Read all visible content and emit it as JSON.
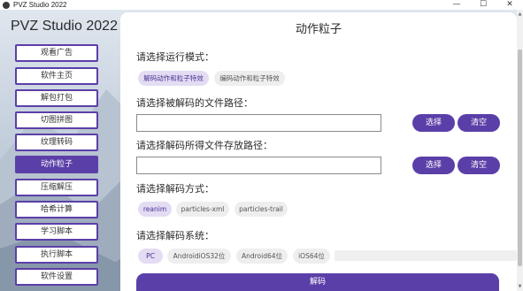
{
  "window": {
    "title": "PVZ Studio 2022",
    "icon": "pvz-logo-icon",
    "controls": {
      "minimize": "—",
      "maximize": "☐",
      "close": "✕"
    }
  },
  "sidebar": {
    "app_title": "PVZ Studio 2022",
    "items": [
      {
        "label": "观看广告",
        "active": false
      },
      {
        "label": "软件主页",
        "active": false
      },
      {
        "label": "解包打包",
        "active": false
      },
      {
        "label": "切图拼图",
        "active": false
      },
      {
        "label": "纹理转码",
        "active": false
      },
      {
        "label": "动作粒子",
        "active": true
      },
      {
        "label": "压缩解压",
        "active": false
      },
      {
        "label": "哈希计算",
        "active": false
      },
      {
        "label": "学习脚本",
        "active": false
      },
      {
        "label": "执行脚本",
        "active": false
      },
      {
        "label": "软件设置",
        "active": false
      }
    ]
  },
  "main": {
    "title": "动作粒子",
    "run_mode": {
      "label": "请选择运行模式：",
      "options": [
        "解码动作和粒子特效",
        "编码动作和粒子特效"
      ],
      "selected": 0
    },
    "input_path": {
      "label": "请选择被解码的文件路径：",
      "value": "",
      "choose": "选择",
      "clear": "清空"
    },
    "output_path": {
      "label": "请选择解码所得文件存放路径：",
      "value": "",
      "choose": "选择",
      "clear": "清空"
    },
    "decode_method": {
      "label": "请选择解码方式：",
      "options": [
        "reanim",
        "particles-xml",
        "particles-trail"
      ],
      "selected": 0
    },
    "decode_system": {
      "label": "请选择解码系统：",
      "options": [
        "PC",
        "AndroidiOS32位",
        "Android64位",
        "iOS64位"
      ],
      "selected": 0
    },
    "decode_button": "解码"
  },
  "colors": {
    "accent": "#5b3fa8",
    "chip_selected_bg": "#e3dcf3",
    "chip_bg": "#eeeeee",
    "panel_bg": "#ffffff"
  }
}
